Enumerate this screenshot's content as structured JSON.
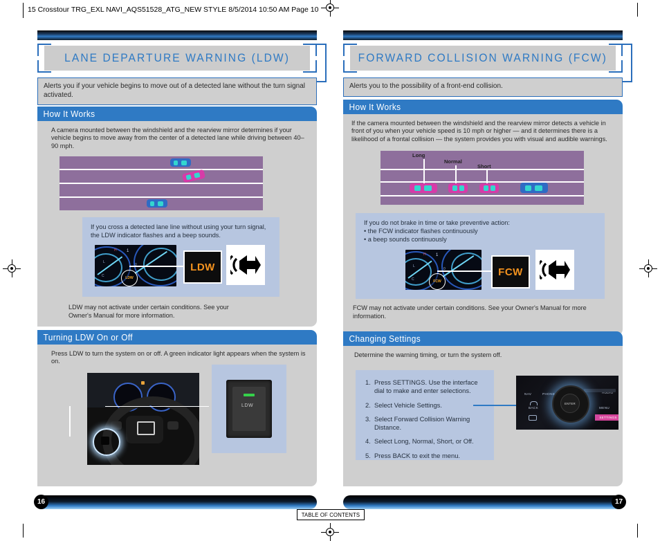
{
  "print_header": {
    "text": "15 Crosstour TRG_EXL NAVI_AQS51528_ATG_NEW STYLE  8/5/2014  10:50 AM  Page 10"
  },
  "colors": {
    "accent_blue": "#2f7ac4",
    "border_blue": "#2a6ebb",
    "panel_gray": "#cfcfcf",
    "title_gray": "#cccccc",
    "callout_blue": "#b7c6e0",
    "road_purple": "#8e6f9c",
    "indicator_amber": "#f5931e",
    "led_green": "#35d14a",
    "settings_pink": "#d6449b"
  },
  "left_page": {
    "title": "LANE DEPARTURE WARNING (LDW)",
    "intro": "Alerts you if your vehicle begins to move out of a detected lane without the turn signal activated.",
    "how_it_works": {
      "heading": "How It Works",
      "body": "A camera mounted between the windshield and the rearview mirror determines if your vehicle begins to move away from the center of a detected lane while driving between 40–90 mph.",
      "callout": {
        "text": "If you cross a detected lane line without using your turn signal, the LDW indicator flashes and a beep sounds.",
        "indicator_label": "LDW",
        "cluster_badge": "LDW"
      },
      "footnote": "LDW may not activate under certain conditions. See your Owner's Manual for more information."
    },
    "turning_on_off": {
      "heading": "Turning LDW On or Off",
      "body": "Press LDW to turn the system on or off.  A green indicator light appears when the system is on.",
      "button_label": "LDW"
    },
    "page_number": "16"
  },
  "right_page": {
    "title": "FORWARD COLLISION WARNING (FCW)",
    "intro": "Alerts you to the possibility of a front-end collision.",
    "how_it_works": {
      "heading": "How It Works",
      "body": "If the camera mounted between the windshield and the rearview mirror detects a vehicle in front of you when your vehicle speed is 10 mph or higher — and it determines there is a likelihood of a frontal collision — the system provides you with visual and audible warnings.",
      "distance_labels": [
        "Long",
        "Normal",
        "Short"
      ],
      "callout": {
        "intro": "If you do not brake in time or take preventive action:",
        "bullets": [
          "• the FCW indicator flashes continuously",
          "• a beep sounds continuously"
        ],
        "indicator_label": "FCW",
        "cluster_badge": "FCW"
      },
      "footnote": "FCW may not activate under certain conditions. See your Owner's Manual for more information."
    },
    "changing_settings": {
      "heading": "Changing Settings",
      "body": "Determine the warning timing, or turn the system off.",
      "steps": [
        {
          "num": "1.",
          "text": "Press SETTINGS. Use the interface dial to make and enter selections."
        },
        {
          "num": "2.",
          "text": "Select Vehicle Settings."
        },
        {
          "num": "3.",
          "text": "Select Forward Collision Warning Distance."
        },
        {
          "num": "4.",
          "text": "Select Long, Normal, Short, or Off."
        },
        {
          "num": "5.",
          "text": "Press BACK to exit the menu."
        }
      ],
      "audio_panel": {
        "nav": "NAV",
        "phone": "PHONE",
        "audio": "AUDIO",
        "back": "BACK",
        "menu": "MENU",
        "settings": "SETTINGS",
        "enter": "ENTER"
      }
    },
    "page_number": "17"
  },
  "footer": {
    "table_of_contents": "TABLE OF CONTENTS"
  }
}
